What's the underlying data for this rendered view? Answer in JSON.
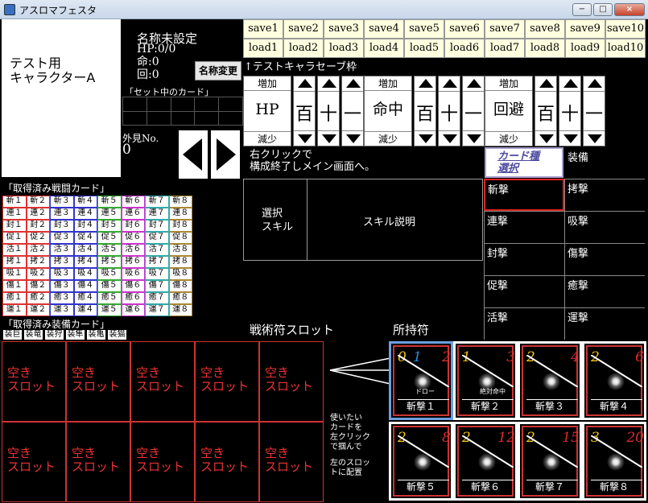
{
  "window": {
    "title": "アスロマフェスタ",
    "min": "−",
    "max": "□",
    "close": "×"
  },
  "character": {
    "display_line1": "テスト用",
    "display_line2": "キャラクターA",
    "name": "名称未設定",
    "hp": "HP:0/0",
    "hit": "命:0",
    "evade": "回:0",
    "rename_button": "名称変更",
    "set_cards_label": "「セット中のカード」",
    "appearance_label": "外見No.",
    "appearance_value": "0"
  },
  "save_load": {
    "saves": [
      "save1",
      "save2",
      "save3",
      "save4",
      "save5",
      "save6",
      "save7",
      "save8",
      "save9",
      "save10"
    ],
    "loads": [
      "load1",
      "load2",
      "load3",
      "load4",
      "load5",
      "load6",
      "load7",
      "load8",
      "load9",
      "load10"
    ],
    "note": "↑テストキャラセーブ枠"
  },
  "stat_editor": {
    "increase": "増加",
    "decrease": "減少",
    "stats": [
      "HP",
      "命中",
      "回避"
    ],
    "digits": [
      "百",
      "十",
      "一"
    ]
  },
  "instruction": {
    "line1": "右クリックで",
    "line2": "構成終了しメイン画面へ。"
  },
  "card_type_button": {
    "line1": "カード種",
    "line2": "選択"
  },
  "equip_label": "装備",
  "skill_panel": {
    "select_line1": "選択",
    "select_line2": "スキル",
    "desc": "スキル説明"
  },
  "categories": [
    "斬撃",
    "拷撃",
    "連撃",
    "吸撃",
    "封撃",
    "傷撃",
    "促撃",
    "癒撃",
    "活撃",
    "運撃"
  ],
  "acquired_battle_label": "「取得済み戦闘カード」",
  "battle_cards": [
    [
      "斬１",
      "斬２",
      "斬３",
      "斬４",
      "斬５",
      "斬６",
      "斬７",
      "斬８"
    ],
    [
      "連１",
      "連２",
      "連３",
      "連４",
      "連５",
      "連６",
      "連７",
      "連８"
    ],
    [
      "封１",
      "封２",
      "封３",
      "封４",
      "封５",
      "封６",
      "封７",
      "封８"
    ],
    [
      "促１",
      "促２",
      "促３",
      "促４",
      "促５",
      "促６",
      "促７",
      "促８"
    ],
    [
      "活１",
      "活２",
      "活３",
      "活４",
      "活５",
      "活６",
      "活７",
      "活８"
    ],
    [
      "拷１",
      "拷２",
      "拷３",
      "拷４",
      "拷５",
      "拷６",
      "拷７",
      "拷８"
    ],
    [
      "吸１",
      "吸２",
      "吸３",
      "吸４",
      "吸５",
      "吸６",
      "吸７",
      "吸８"
    ],
    [
      "傷１",
      "傷２",
      "傷３",
      "傷４",
      "傷５",
      "傷６",
      "傷７",
      "傷８"
    ],
    [
      "癒１",
      "癒２",
      "癒３",
      "癒４",
      "癒５",
      "癒６",
      "癒７",
      "癒８"
    ],
    [
      "運１",
      "運２",
      "運３",
      "運４",
      "運５",
      "運６",
      "運７",
      "運８"
    ]
  ],
  "acquired_equip_label": "「取得済み装備カード」",
  "equip_cards": [
    "装巨",
    "装竜",
    "装狩",
    "装隼",
    "装亀",
    "装猫"
  ],
  "tactic_slot_label": "戦術符スロット",
  "owned_label": "所持符",
  "empty_slot": {
    "line1": "空き",
    "line2": "スロット"
  },
  "hint": [
    "使いたい",
    "カードを",
    "左クリック",
    "で掴んで",
    "",
    "左のスロッ",
    "トに配置"
  ],
  "owned_cards": [
    {
      "n1": "0",
      "n2": "1",
      "n3": "2",
      "tag": "ドロー",
      "name": "斬撃１",
      "highlight": true
    },
    {
      "n1": "1",
      "n2": "",
      "n3": "3",
      "tag": "絶対命中",
      "name": "斬撃２",
      "highlight": false
    },
    {
      "n1": "2",
      "n2": "",
      "n3": "4",
      "tag": "",
      "name": "斬撃３",
      "highlight": false
    },
    {
      "n1": "2",
      "n2": "",
      "n3": "6",
      "tag": "",
      "name": "斬撃４",
      "highlight": false
    },
    {
      "n1": "2",
      "n2": "",
      "n3": "8",
      "tag": "",
      "name": "斬撃５",
      "highlight": false
    },
    {
      "n1": "2",
      "n2": "",
      "n3": "12",
      "tag": "",
      "name": "斬撃６",
      "highlight": false
    },
    {
      "n1": "2",
      "n2": "",
      "n3": "15",
      "tag": "",
      "name": "斬撃７",
      "highlight": false
    },
    {
      "n1": "3",
      "n2": "",
      "n3": "20",
      "tag": "",
      "name": "斬撃８",
      "highlight": false
    }
  ]
}
